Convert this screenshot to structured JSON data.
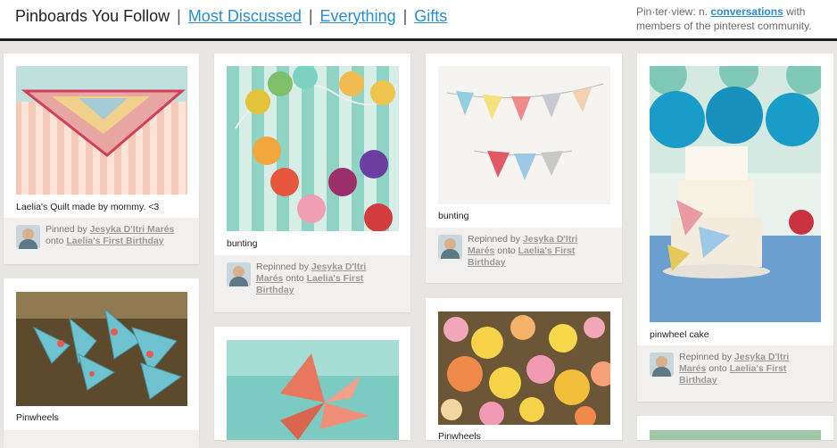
{
  "header": {
    "current": "Pinboards You Follow",
    "links": [
      "Most Discussed",
      "Everything",
      "Gifts"
    ],
    "tagline": {
      "term": "Pin·ter·view:",
      "pre": "n.",
      "link": "conversations",
      "post": "with members of the pinterest community."
    }
  },
  "pins": [
    {
      "caption": "Laelia's Quilt made by mommy. <3",
      "verb": "Pinned by",
      "user": "Jesyka D'Itri Marés",
      "onto": "onto",
      "board": "Laelia's First Birthday"
    },
    {
      "caption": "bunting",
      "verb": "Repinned by",
      "user": "Jesyka D'Itri Marés",
      "onto": "onto",
      "board": "Laelia's First Birthday"
    },
    {
      "caption": "bunting",
      "verb": "Repinned by",
      "user": "Jesyka D'Itri Marés",
      "onto": "onto",
      "board": "Laelia's First Birthday"
    },
    {
      "caption": "pinwheel cake",
      "verb": "Repinned by",
      "user": "Jesyka D'Itri Marés",
      "onto": "onto",
      "board": "Laelia's First Birthday"
    },
    {
      "caption": "Pinwheels"
    },
    {
      "caption": "Pinwheels"
    }
  ],
  "colors": {
    "link": "#2b8ccf",
    "page_bg": "#e8e6e3",
    "meta_bg": "#f2f0ee"
  }
}
